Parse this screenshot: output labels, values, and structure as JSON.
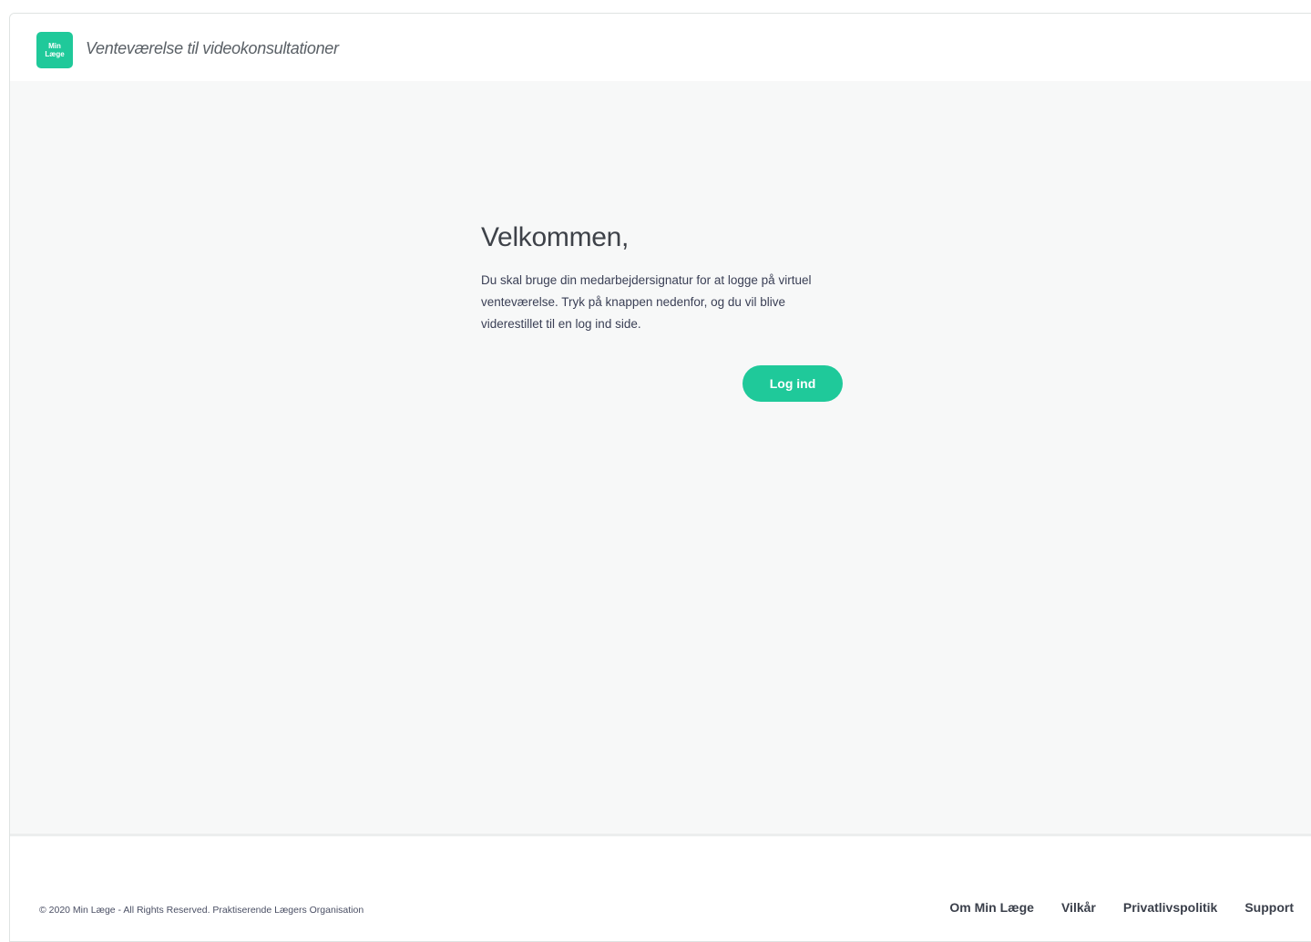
{
  "header": {
    "logo_line1": "Min",
    "logo_line2": "Læge",
    "title": "Venteværelse til videokonsultationer"
  },
  "main": {
    "heading": "Velkommen,",
    "description": "Du skal bruge din medarbejdersignatur for at logge på virtuel venteværelse. Tryk på knappen nedenfor, og du vil blive viderestillet til en log ind side.",
    "login_button": "Log ind"
  },
  "footer": {
    "copyright": "© 2020 Min Læge - All Rights Reserved. Praktiserende Lægers Organisation",
    "links": [
      "Om Min Læge",
      "Vilkår",
      "Privatlivspolitik",
      "Support"
    ]
  },
  "colors": {
    "accent": "#1fc99a",
    "background": "#f7f8f8"
  }
}
